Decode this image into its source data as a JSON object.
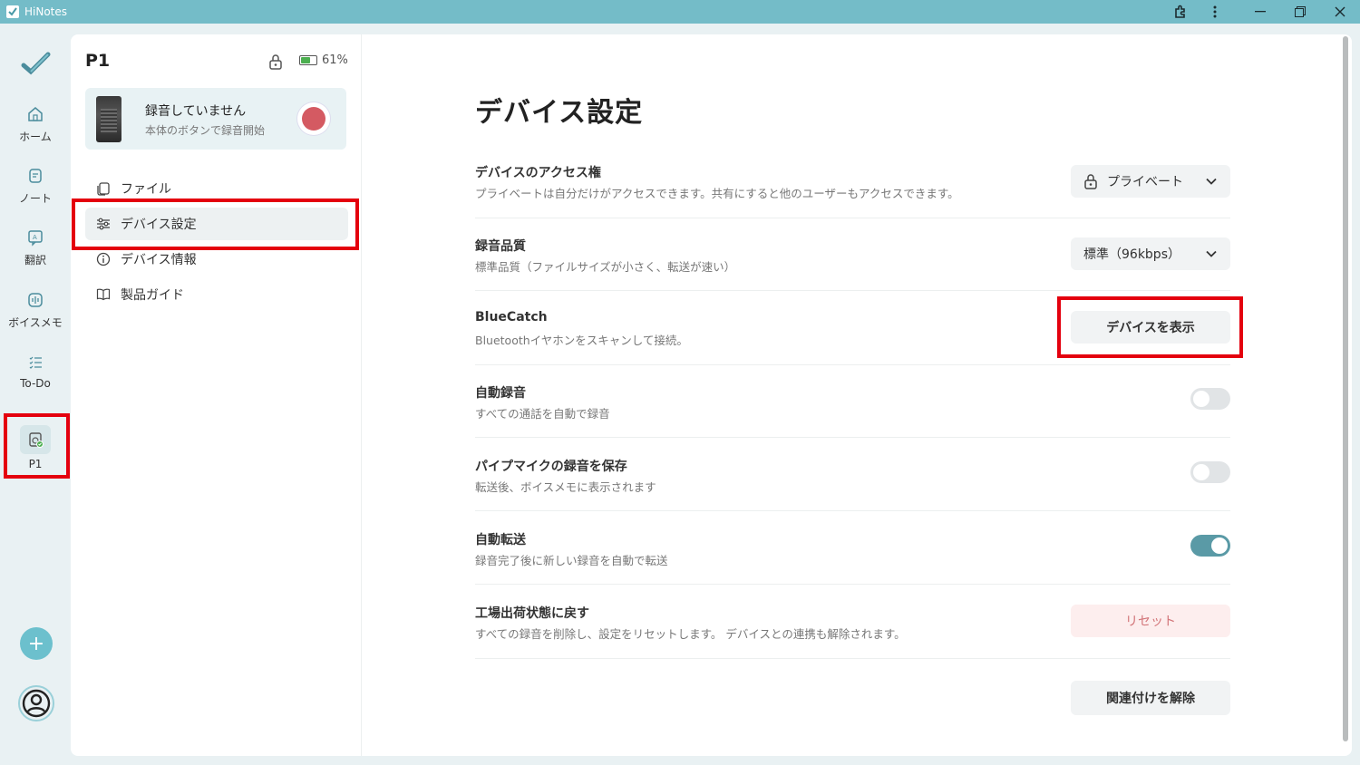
{
  "titlebar": {
    "app_title": "HiNotes"
  },
  "rail": {
    "items": [
      {
        "label": "ホーム",
        "icon": "home-icon"
      },
      {
        "label": "ノート",
        "icon": "note-icon"
      },
      {
        "label": "翻訳",
        "icon": "translate-icon"
      },
      {
        "label": "ボイスメモ",
        "icon": "voice-memo-icon"
      },
      {
        "label": "To-Do",
        "icon": "todo-list-icon"
      },
      {
        "label": "P1",
        "icon": "device-icon"
      }
    ],
    "add_label": "+"
  },
  "device_panel": {
    "name": "P1",
    "battery_percent": "61%",
    "battery_level": 0.61,
    "recording": {
      "title": "録音していません",
      "subtitle": "本体のボタンで録音開始"
    },
    "menu": [
      {
        "label": "ファイル",
        "icon": "files-icon"
      },
      {
        "label": "デバイス設定",
        "icon": "sliders-icon",
        "active": true
      },
      {
        "label": "デバイス情報",
        "icon": "info-icon"
      },
      {
        "label": "製品ガイド",
        "icon": "book-icon"
      }
    ]
  },
  "settings": {
    "title": "デバイス設定",
    "rows": [
      {
        "title": "デバイスのアクセス権",
        "desc": "プライベートは自分だけがアクセスできます。共有にすると他のユーザーもアクセスできます。",
        "control": "dropdown",
        "value": "プライベート"
      },
      {
        "title": "録音品質",
        "desc": "標準品質（ファイルサイズが小さく、転送が速い）",
        "control": "dropdown",
        "value": "標準（96kbps）"
      },
      {
        "title": "BlueCatch",
        "desc": "Bluetoothイヤホンをスキャンして接続。",
        "control": "button",
        "value": "デバイスを表示"
      },
      {
        "title": "自動録音",
        "desc": "すべての通話を自動で録音",
        "control": "toggle",
        "on": false
      },
      {
        "title": "パイプマイクの録音を保存",
        "desc": "転送後、ボイスメモに表示されます",
        "control": "toggle",
        "on": false
      },
      {
        "title": "自動転送",
        "desc": "録音完了後に新しい録音を自動で転送",
        "control": "toggle",
        "on": true
      },
      {
        "title": "工場出荷状態に戻す",
        "desc": "すべての録音を削除し、設定をリセットします。 デバイスとの連携も解除されます。",
        "control": "button-danger",
        "value": "リセット"
      }
    ],
    "unlink_label": "関連付けを解除"
  },
  "colors": {
    "titlebar": "#74bcc8",
    "accent": "#5a9aa6",
    "record": "#d45a62",
    "highlight": "#e4000e"
  }
}
